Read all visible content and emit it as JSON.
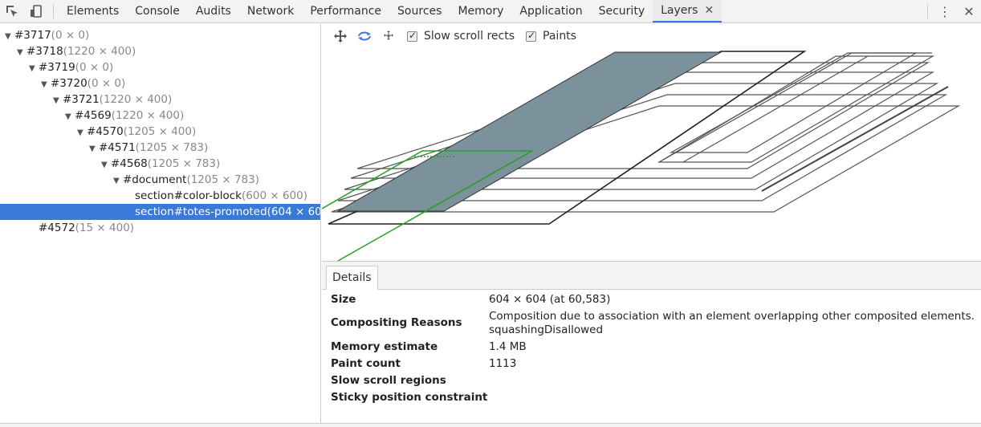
{
  "tabbar": {
    "tabs": [
      "Elements",
      "Console",
      "Audits",
      "Network",
      "Performance",
      "Sources",
      "Memory",
      "Application",
      "Security",
      "Layers"
    ],
    "close_glyph": "✕",
    "menu_glyph": "⋮",
    "window_close_glyph": "✕"
  },
  "icons": {
    "inspect": "inspect-element-icon",
    "device": "device-toolbar-icon",
    "pan": "pan-mode-icon",
    "rotate": "rotate-mode-icon",
    "reset": "reset-transform-icon"
  },
  "tree": {
    "rows": [
      {
        "arrow": "▼",
        "name": "#3717",
        "dims": "(0 × 0)"
      },
      {
        "arrow": "▼",
        "name": "#3718",
        "dims": "(1220 × 400)"
      },
      {
        "arrow": "▼",
        "name": "#3719",
        "dims": "(0 × 0)"
      },
      {
        "arrow": "▼",
        "name": "#3720",
        "dims": "(0 × 0)"
      },
      {
        "arrow": "▼",
        "name": "#3721",
        "dims": "(1220 × 400)"
      },
      {
        "arrow": "▼",
        "name": "#4569",
        "dims": "(1220 × 400)"
      },
      {
        "arrow": "▼",
        "name": "#4570",
        "dims": "(1205 × 400)"
      },
      {
        "arrow": "▼",
        "name": "#4571",
        "dims": "(1205 × 783)"
      },
      {
        "arrow": "▼",
        "name": "#4568",
        "dims": "(1205 × 783)"
      },
      {
        "arrow": "▼",
        "name": "#document",
        "dims": "(1205 × 783)"
      },
      {
        "arrow": "",
        "name": "section#color-block",
        "dims": "(600 × 600)"
      },
      {
        "arrow": "",
        "name": "section#totes-promoted",
        "dims": "(604 × 60"
      },
      {
        "arrow": "",
        "name": "#4572",
        "dims": "(15 × 400)"
      }
    ]
  },
  "layer_toolbar": {
    "slow_scroll_label": "Slow scroll rects",
    "paints_label": "Paints"
  },
  "details": {
    "tab_label": "Details",
    "rows": [
      {
        "label": "Size",
        "value": "604 × 604 (at 60,583)"
      },
      {
        "label": "Compositing Reasons",
        "value": "Composition due to association with an element overlapping other composited elements.",
        "value2": "squashingDisallowed"
      },
      {
        "label": "Memory estimate",
        "value": "1.4 MB"
      },
      {
        "label": "Paint count",
        "value": "1113"
      },
      {
        "label": "Slow scroll regions",
        "value": ""
      },
      {
        "label": "Sticky position constraint",
        "value": ""
      }
    ]
  },
  "colors": {
    "accent": "#3879d9",
    "selected_layer_fill": "#7b919b",
    "green_outline": "#1fa31f"
  }
}
